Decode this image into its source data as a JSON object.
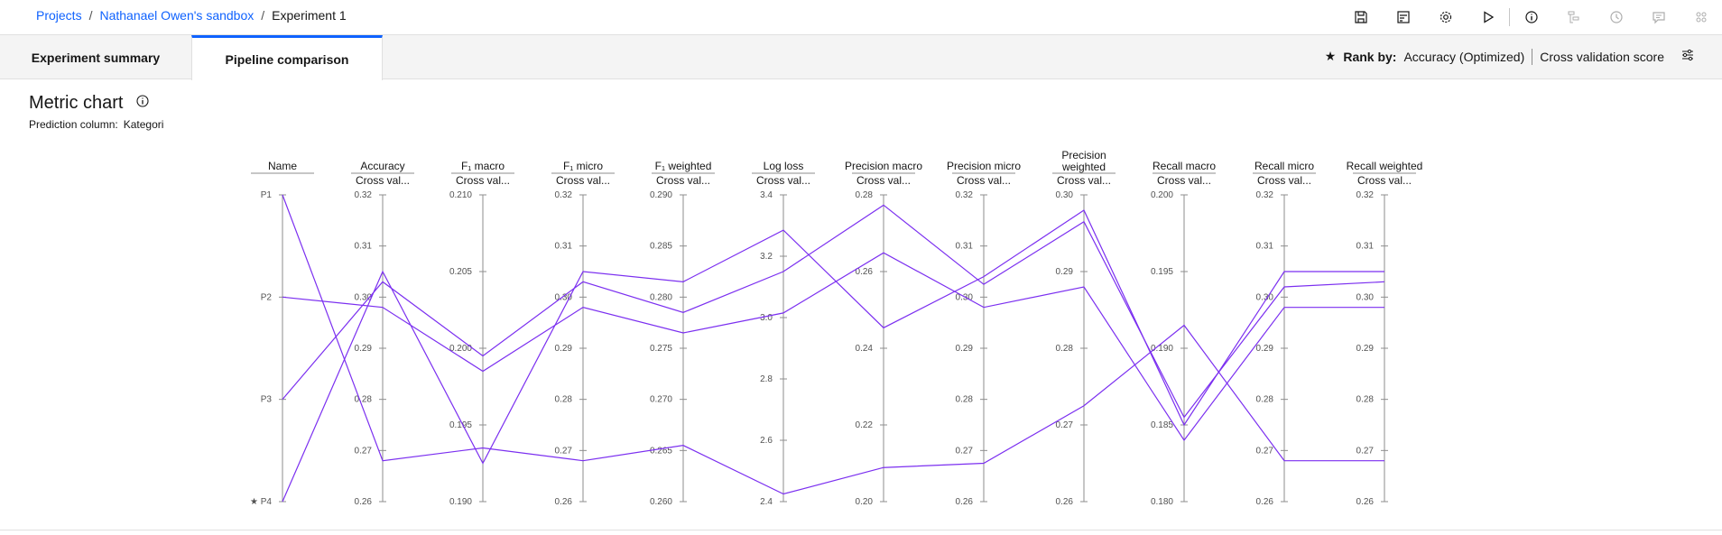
{
  "breadcrumb": {
    "items": [
      "Projects",
      "Nathanael Owen's sandbox"
    ],
    "current": "Experiment 1"
  },
  "toolbar": {
    "icons": [
      "save-icon",
      "save-as-icon",
      "settings-icon",
      "run-icon",
      "info-icon",
      "tree-icon",
      "history-icon",
      "comment-icon",
      "apps-icon"
    ]
  },
  "tabs": [
    {
      "label": "Experiment summary",
      "selected": false
    },
    {
      "label": "Pipeline comparison",
      "selected": true
    }
  ],
  "rank": {
    "label": "Rank by:",
    "metric": "Accuracy (Optimized)",
    "score": "Cross validation score"
  },
  "metric_chart": {
    "title": "Metric chart",
    "prediction_label": "Prediction column:",
    "prediction_value": "Kategori"
  },
  "colors": {
    "accent": "#0f62fe",
    "line": "#7b2ff0",
    "axis": "#8d8d8d"
  },
  "chart_data": {
    "type": "parallel_coordinates",
    "axes": [
      {
        "name": "Name",
        "sub": "",
        "ticks": [
          "P1",
          "P2",
          "P3",
          "★ P4"
        ],
        "range": null
      },
      {
        "name": "Accuracy",
        "sub": "Cross val...",
        "ticks": [
          "0.32",
          "0.31",
          "0.30",
          "0.29",
          "0.28",
          "0.27",
          "0.26"
        ],
        "range": [
          0.26,
          0.32
        ]
      },
      {
        "name": "F₁ macro",
        "sub": "Cross val...",
        "ticks": [
          "0.210",
          "0.205",
          "0.200",
          "0.195",
          "0.190"
        ],
        "range": [
          0.19,
          0.21
        ]
      },
      {
        "name": "F₁ micro",
        "sub": "Cross val...",
        "ticks": [
          "0.32",
          "0.31",
          "0.30",
          "0.29",
          "0.28",
          "0.27",
          "0.26"
        ],
        "range": [
          0.26,
          0.32
        ]
      },
      {
        "name": "F₁ weighted",
        "sub": "Cross val...",
        "ticks": [
          "0.290",
          "0.285",
          "0.280",
          "0.275",
          "0.270",
          "0.265",
          "0.260"
        ],
        "range": [
          0.26,
          0.29
        ]
      },
      {
        "name": "Log loss",
        "sub": "Cross val...",
        "ticks": [
          "3.4",
          "3.2",
          "3.0",
          "2.8",
          "2.6",
          "2.4"
        ],
        "range": [
          2.4,
          3.4
        ]
      },
      {
        "name": "Precision macro",
        "sub": "Cross val...",
        "ticks": [
          "0.28",
          "0.26",
          "0.24",
          "0.22",
          "0.20"
        ],
        "range": [
          0.2,
          0.29
        ]
      },
      {
        "name": "Precision micro",
        "sub": "Cross val...",
        "ticks": [
          "0.32",
          "0.31",
          "0.30",
          "0.29",
          "0.28",
          "0.27",
          "0.26"
        ],
        "range": [
          0.26,
          0.32
        ]
      },
      {
        "name": "Precision weighted",
        "sub": "Cross val...",
        "ticks": [
          "0.30",
          "0.29",
          "0.28",
          "0.27",
          "0.26"
        ],
        "range": [
          0.26,
          0.3
        ]
      },
      {
        "name": "Recall macro",
        "sub": "Cross val...",
        "ticks": [
          "0.200",
          "0.195",
          "0.190",
          "0.185",
          "0.180"
        ],
        "range": [
          0.18,
          0.2
        ]
      },
      {
        "name": "Recall micro",
        "sub": "Cross val...",
        "ticks": [
          "0.32",
          "0.31",
          "0.30",
          "0.29",
          "0.28",
          "0.27",
          "0.26"
        ],
        "range": [
          0.26,
          0.32
        ]
      },
      {
        "name": "Recall weighted",
        "sub": "Cross val...",
        "ticks": [
          "0.32",
          "0.31",
          "0.30",
          "0.29",
          "0.28",
          "0.27",
          "0.26"
        ],
        "range": [
          0.26,
          0.32
        ]
      }
    ],
    "series": [
      {
        "pipeline": "P1",
        "values": [
          0.268,
          0.1935,
          0.268,
          0.2655,
          2.425,
          0.21,
          0.2675,
          0.2725,
          0.1915,
          0.268,
          0.268
        ]
      },
      {
        "pipeline": "P2",
        "values": [
          0.298,
          0.1985,
          0.298,
          0.2765,
          3.015,
          0.273,
          0.298,
          0.288,
          0.184,
          0.298,
          0.298
        ]
      },
      {
        "pipeline": "P3",
        "values": [
          0.303,
          0.1995,
          0.303,
          0.2785,
          3.15,
          0.287,
          0.3025,
          0.2965,
          0.1855,
          0.302,
          0.303
        ]
      },
      {
        "pipeline": "P4",
        "values": [
          0.305,
          0.1925,
          0.305,
          0.2815,
          3.285,
          0.251,
          0.304,
          0.298,
          0.185,
          0.305,
          0.305
        ]
      }
    ]
  }
}
